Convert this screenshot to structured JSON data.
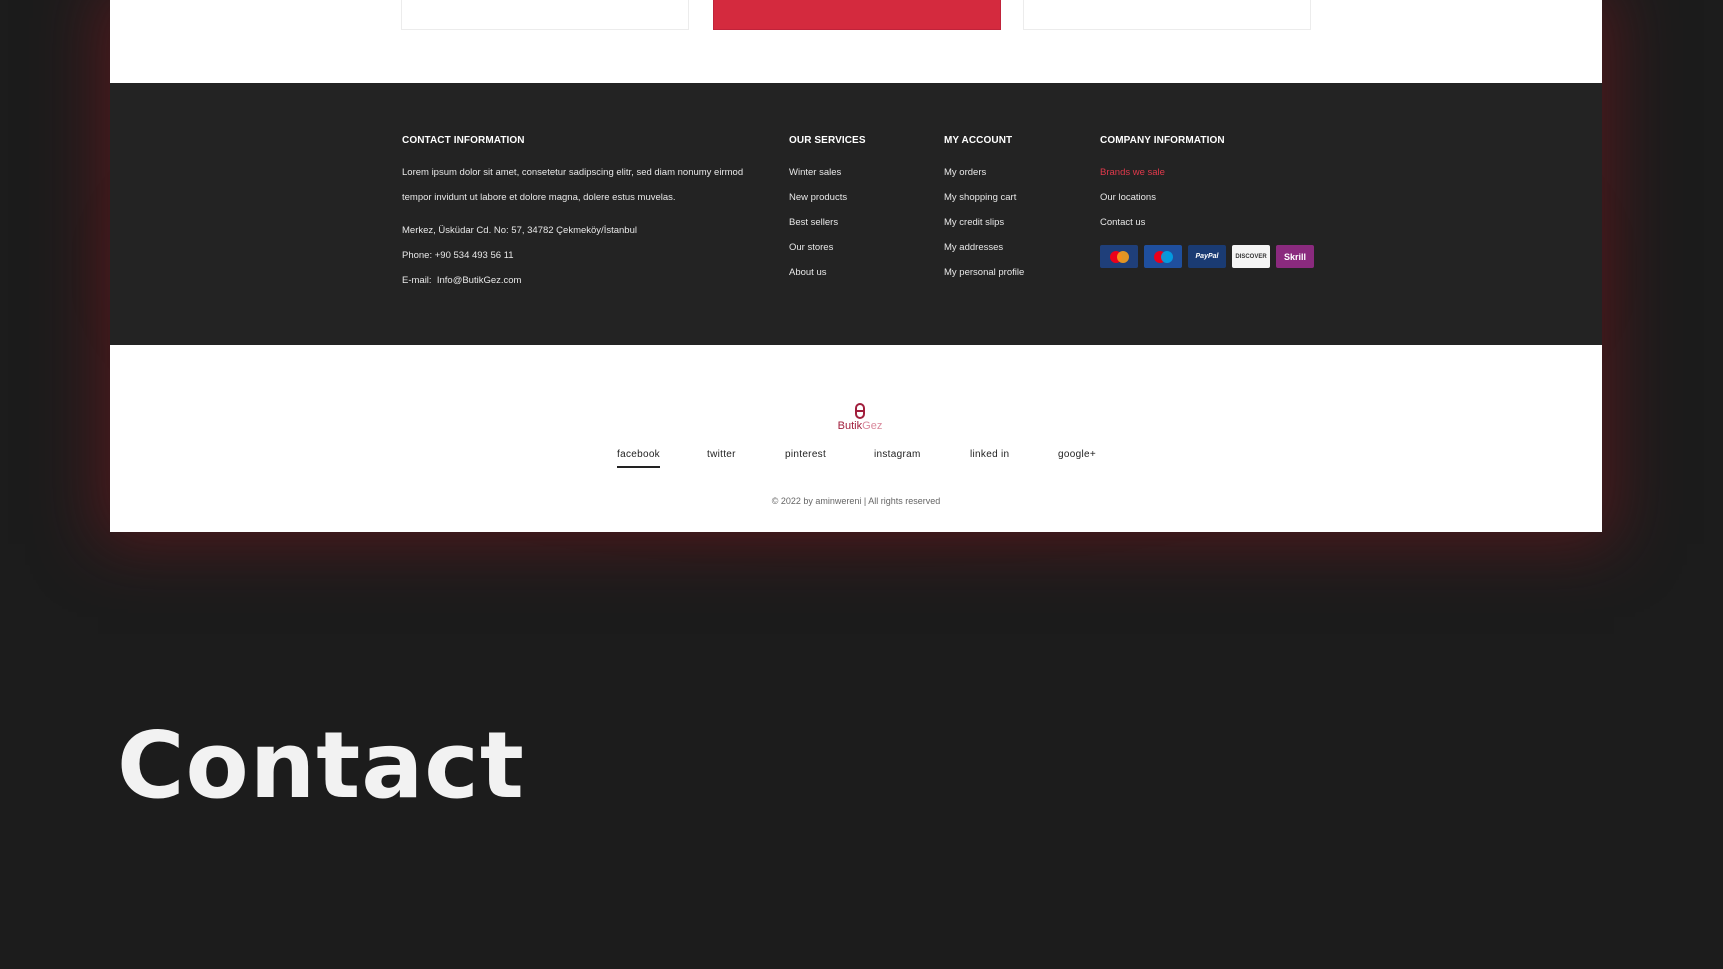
{
  "footer": {
    "contact": {
      "heading": "CONTACT INFORMATION",
      "text_line_1": "Lorem ipsum dolor sit amet, consetetur sadipscing elitr, sed diam nonumy eirmod",
      "text_line_2": "tempor invidunt ut labore et dolore magna, dolere estus muvelas.",
      "address": "Merkez, Üsküdar Cd. No: 57, 34782 Çekmeköy/İstanbul",
      "phone": "Phone: +90 534 493 56 11",
      "email_label": "E-mail:",
      "email": "Info@ButikGez.com"
    },
    "services": {
      "heading": "OUR SERVICES",
      "items": [
        "Winter sales",
        "New products",
        "Best sellers",
        "Our stores",
        "About us"
      ]
    },
    "account": {
      "heading": "MY ACCOUNT",
      "items": [
        "My orders",
        "My shopping cart",
        "My credit slips",
        "My addresses",
        "My personal profile"
      ]
    },
    "company": {
      "heading": "COMPANY INFORMATION",
      "items": [
        "Brands we sale",
        "Our locations",
        "Contact us"
      ],
      "accent_color": "#e0394b",
      "payments": [
        {
          "name": "mastercard-icon",
          "label": "MasterCard"
        },
        {
          "name": "maestro-icon",
          "label": "Maestro"
        },
        {
          "name": "paypal-icon",
          "label": "PayPal"
        },
        {
          "name": "discover-icon",
          "label": "DISCOVER"
        },
        {
          "name": "skrill-icon",
          "label": "Skrill"
        }
      ]
    }
  },
  "brand": {
    "name_part1": "Butik",
    "name_part2": "Gez",
    "color": "#a11e3c"
  },
  "social": [
    "facebook",
    "twitter",
    "pinterest",
    "instagram",
    "linked in",
    "google+"
  ],
  "copyright": "© 2022 by aminwereni | All rights reserved",
  "section_title": "Contact",
  "colors": {
    "background": "#1c1c1c",
    "footer_dark": "#232323",
    "accent_red": "#d42a3e"
  }
}
